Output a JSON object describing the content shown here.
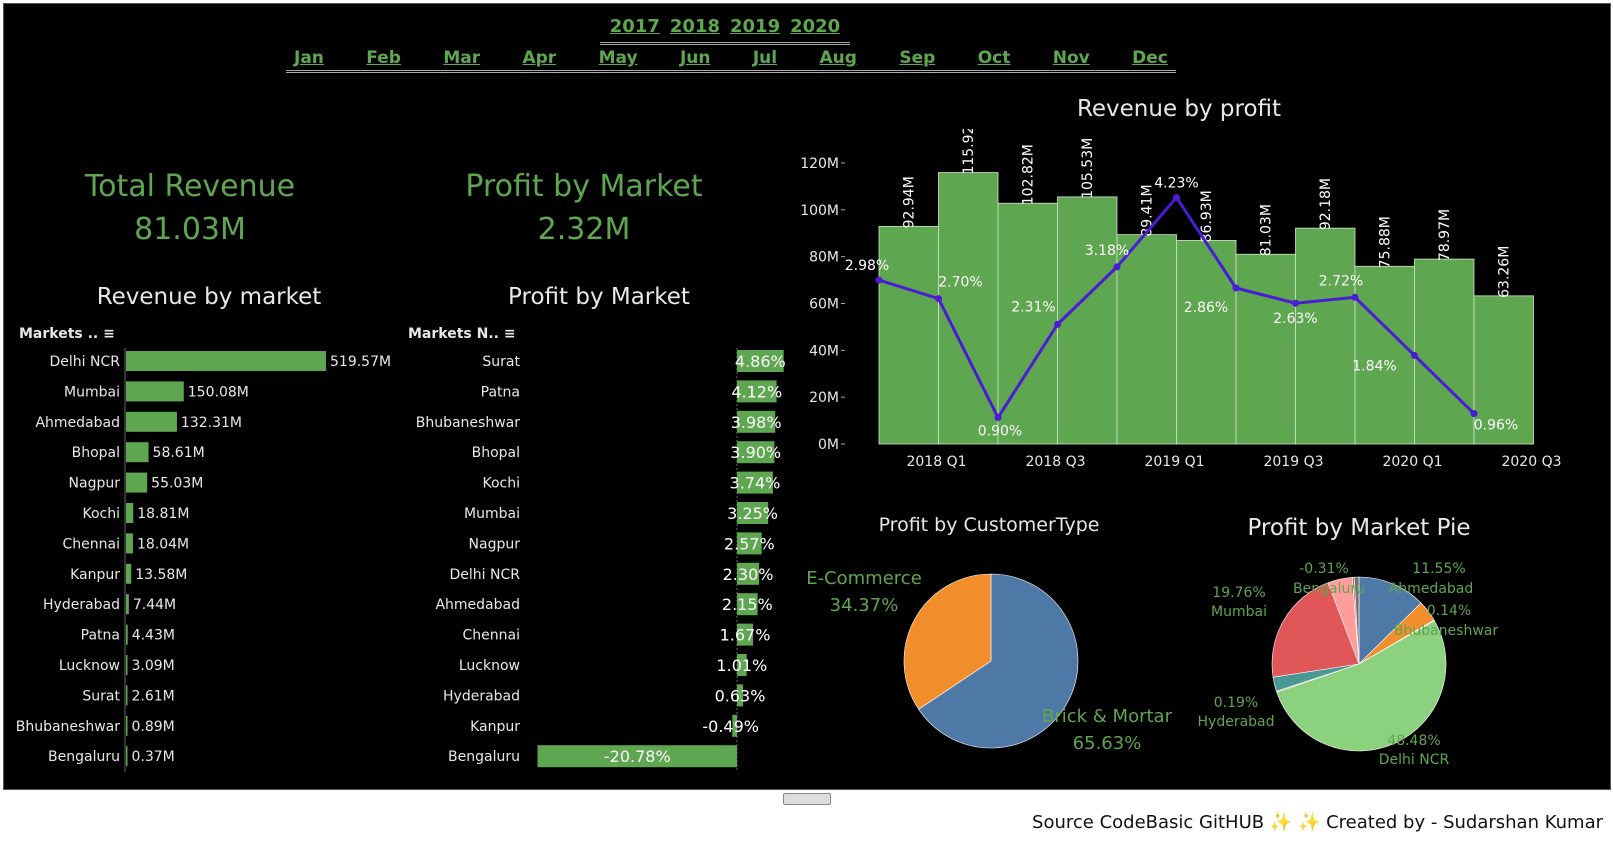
{
  "filters": {
    "years": [
      "2017",
      "2018",
      "2019",
      "2020"
    ],
    "months": [
      "Jan",
      "Feb",
      "Mar",
      "Apr",
      "May",
      "Jun",
      "Jul",
      "Aug",
      "Sep",
      "Oct",
      "Nov",
      "Dec"
    ]
  },
  "kpis": {
    "total_revenue": {
      "label": "Total Revenue",
      "value": "81.03M"
    },
    "profit_by_market": {
      "label": "Profit by Market",
      "value": "2.32M"
    }
  },
  "footer": {
    "credit": "Source CodeBasic GitHUB ✨ ✨ Created by - Sudarshan Kumar"
  },
  "colors": {
    "green": "#5ea64f",
    "bar_green": "#5ea64f",
    "line_purple": "#4b1bd6",
    "blue": "#4e79a7",
    "orange": "#f28e2b"
  },
  "chart_data": [
    {
      "id": "revenue-by-market",
      "type": "bar",
      "title": "Revenue by market",
      "column_header": "Markets ..",
      "categories": [
        "Delhi NCR",
        "Mumbai",
        "Ahmedabad",
        "Bhopal",
        "Nagpur",
        "Kochi",
        "Chennai",
        "Kanpur",
        "Hyderabad",
        "Patna",
        "Lucknow",
        "Surat",
        "Bhubaneshwar",
        "Bengaluru"
      ],
      "values": [
        519.57,
        150.08,
        132.31,
        58.61,
        55.03,
        18.81,
        18.04,
        13.58,
        7.44,
        4.43,
        3.09,
        2.61,
        0.89,
        0.37
      ],
      "labels": [
        "519.57M",
        "150.08M",
        "132.31M",
        "58.61M",
        "55.03M",
        "18.81M",
        "18.04M",
        "13.58M",
        "7.44M",
        "4.43M",
        "3.09M",
        "2.61M",
        "0.89M",
        "0.37M"
      ],
      "unit": "M"
    },
    {
      "id": "profit-by-market",
      "type": "bar",
      "title": "Profit by Market",
      "column_header": "Markets N..",
      "categories": [
        "Surat",
        "Patna",
        "Bhubaneshwar",
        "Bhopal",
        "Kochi",
        "Mumbai",
        "Nagpur",
        "Delhi NCR",
        "Ahmedabad",
        "Chennai",
        "Lucknow",
        "Hyderabad",
        "Kanpur",
        "Bengaluru"
      ],
      "values": [
        4.86,
        4.12,
        3.98,
        3.9,
        3.74,
        3.25,
        2.57,
        2.3,
        2.15,
        1.67,
        1.01,
        0.63,
        -0.49,
        -20.78
      ],
      "labels": [
        "4.86%",
        "4.12%",
        "3.98%",
        "3.90%",
        "3.74%",
        "3.25%",
        "2.57%",
        "2.30%",
        "2.15%",
        "1.67%",
        "1.01%",
        "0.63%",
        "-0.49%",
        "-20.78%"
      ],
      "unit": "%"
    },
    {
      "id": "revenue-by-profit",
      "type": "bar",
      "title": "Revenue by profit",
      "x_tick_labels": [
        "2018 Q1",
        "2018 Q3",
        "2019 Q1",
        "2019 Q3",
        "2020 Q1",
        "2020 Q3"
      ],
      "y_tick_labels": [
        "0M",
        "20M",
        "40M",
        "60M",
        "80M",
        "100M",
        "120M"
      ],
      "ylim": [
        0,
        120
      ],
      "bar_values": [
        92.94,
        115.92,
        102.82,
        105.53,
        89.41,
        86.93,
        81.03,
        92.18,
        75.88,
        78.97,
        63.26
      ],
      "bar_labels": [
        "92.94M",
        "115.92M",
        "102.82M",
        "105.53M",
        "89.41M",
        "86.93M",
        "81.03M",
        "92.18M",
        "75.88M",
        "78.97M",
        "63.26M"
      ],
      "line_values": [
        2.98,
        2.7,
        0.9,
        2.31,
        3.18,
        4.23,
        2.86,
        2.63,
        2.72,
        1.84,
        0.96
      ],
      "line_labels": [
        "2.98%",
        "2.70%",
        "0.90%",
        "2.31%",
        "3.18%",
        "4.23%",
        "2.86%",
        "2.63%",
        "2.72%",
        "1.84%",
        "0.96%"
      ],
      "line_ylim": [
        0.5,
        4.6
      ]
    },
    {
      "id": "profit-by-customertype",
      "type": "pie",
      "title": "Profit by CustomerType",
      "slices": [
        {
          "label": "Brick & Mortar",
          "value": 65.63,
          "text": "65.63%",
          "color": "#4e79a7"
        },
        {
          "label": "E-Commerce",
          "value": 34.37,
          "text": "34.37%",
          "color": "#f28e2b"
        }
      ]
    },
    {
      "id": "profit-by-market-pie",
      "type": "pie",
      "title": "Profit by Market Pie",
      "slices": [
        {
          "label": "Ahmedabad",
          "value": 11.55,
          "text": "11.55%",
          "color": "#4e79a7"
        },
        {
          "label": "",
          "value": 3.6,
          "text": "",
          "color": "#f28e2b"
        },
        {
          "label": "Bhubaneshwar",
          "value": 0.14,
          "text": "0.14%",
          "color": "#59a14f"
        },
        {
          "label": "Delhi NCR",
          "value": 48.48,
          "text": "48.48%",
          "color": "#8cd17d"
        },
        {
          "label": "Hyderabad",
          "value": 0.19,
          "text": "0.19%",
          "color": "#b6992d"
        },
        {
          "label": "",
          "value": 2.4,
          "text": "",
          "color": "#499894"
        },
        {
          "label": "Mumbai",
          "value": 19.76,
          "text": "19.76%",
          "color": "#e15759"
        },
        {
          "label": "",
          "value": 4.2,
          "text": "",
          "color": "#ff9d9a"
        },
        {
          "label": "Bengaluru",
          "value": 0.31,
          "text": "-0.31%",
          "color": "#9d7660"
        },
        {
          "label": "",
          "value": 0.8,
          "text": "",
          "color": "#79706e"
        }
      ]
    }
  ]
}
